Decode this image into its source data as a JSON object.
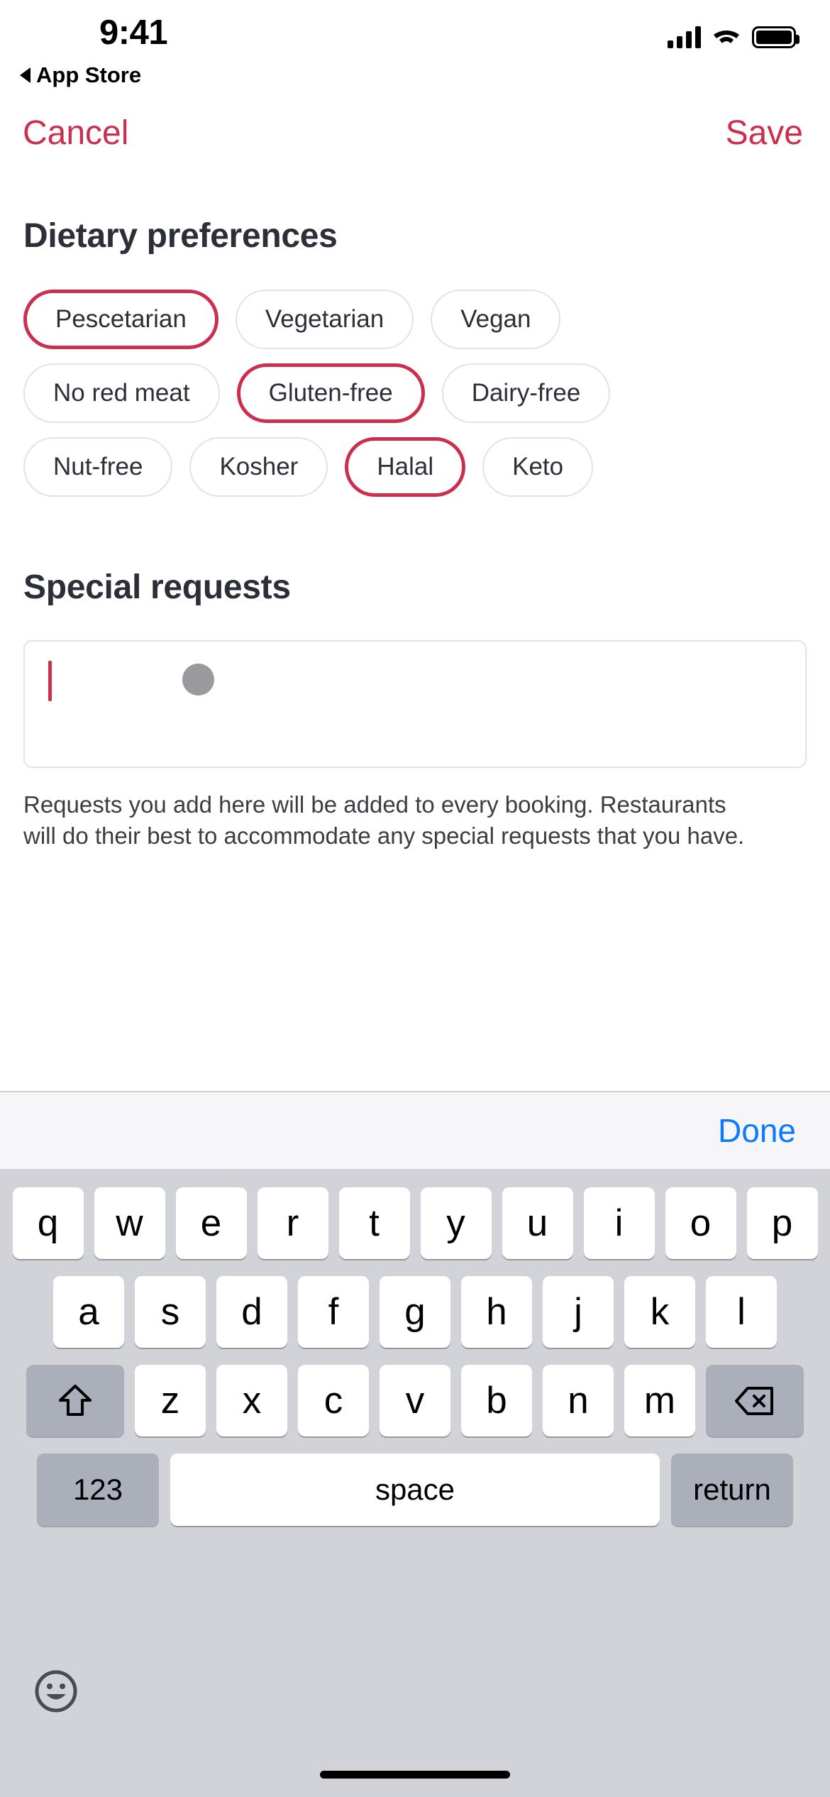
{
  "status_bar": {
    "time": "9:41",
    "back_label": "App Store",
    "icons": [
      "cellular-signal-icon",
      "wifi-icon",
      "battery-icon"
    ]
  },
  "nav": {
    "cancel_label": "Cancel",
    "save_label": "Save"
  },
  "colors": {
    "accent": "#CC2E4E",
    "ios_blue": "#0A7AFF",
    "text_dark": "#2D2F38",
    "chip_border": "#E2E3E6",
    "keyboard_bg": "#D1D3D9",
    "key_gray": "#ABAFBA"
  },
  "dietary": {
    "title": "Dietary preferences",
    "rows": [
      [
        {
          "label": "Pescetarian",
          "selected": true
        },
        {
          "label": "Vegetarian",
          "selected": false
        },
        {
          "label": "Vegan",
          "selected": false
        }
      ],
      [
        {
          "label": "No red meat",
          "selected": false
        },
        {
          "label": "Gluten-free",
          "selected": true
        },
        {
          "label": "Dairy-free",
          "selected": false
        }
      ],
      [
        {
          "label": "Nut-free",
          "selected": false
        },
        {
          "label": "Kosher",
          "selected": false
        },
        {
          "label": "Halal",
          "selected": true
        },
        {
          "label": "Keto",
          "selected": false
        }
      ]
    ]
  },
  "special_requests": {
    "title": "Special requests",
    "value": "",
    "placeholder": "",
    "helper_text": "Requests you add here will be added to every booking. Restaurants will do their best to accommodate any special requests that you have."
  },
  "keyboard": {
    "done_label": "Done",
    "row1": [
      "q",
      "w",
      "e",
      "r",
      "t",
      "y",
      "u",
      "i",
      "o",
      "p"
    ],
    "row2": [
      "a",
      "s",
      "d",
      "f",
      "g",
      "h",
      "j",
      "k",
      "l"
    ],
    "row3": [
      "z",
      "x",
      "c",
      "v",
      "b",
      "n",
      "m"
    ],
    "shift_icon": "shift-arrow-icon",
    "backspace_icon": "backspace-icon",
    "numbers_label": "123",
    "space_label": "space",
    "return_label": "return",
    "emoji_icon": "emoji-smiley-icon"
  }
}
